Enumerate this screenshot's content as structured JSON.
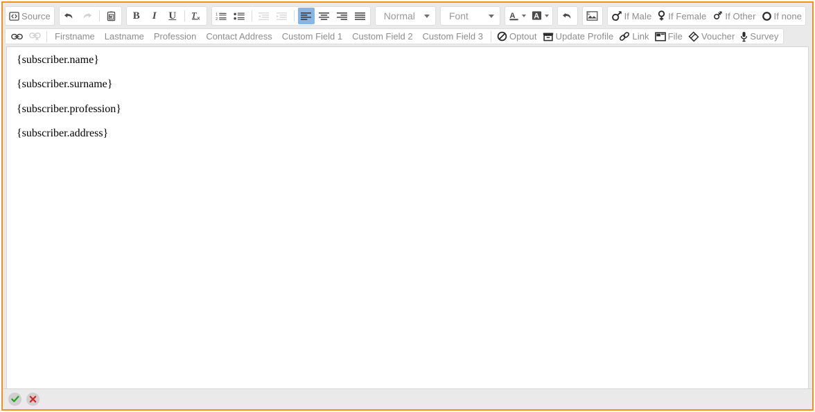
{
  "editor": {
    "frame_accent_color": "#f0901e",
    "toolbar_bg": "#eaeaea",
    "active_button_color": "#86b5e6"
  },
  "toolbar": {
    "row1": {
      "source_label": "Source",
      "undo_title": "Undo",
      "redo_title": "Redo",
      "paste_word_title": "Paste from Word",
      "bold_label": "B",
      "italic_label": "I",
      "underline_label": "U",
      "remove_format_label": "Tx",
      "numbered_list_title": "Insert/Remove Numbered List",
      "bulleted_list_title": "Insert/Remove Bulleted List",
      "outdent_title": "Decrease Indent",
      "indent_title": "Increase Indent",
      "align_left_title": "Align Left",
      "align_center_title": "Center",
      "align_right_title": "Align Right",
      "justify_title": "Justify",
      "paragraph_format": "Normal",
      "font_name": "Font",
      "text_color_title": "Text Color",
      "bg_color_title": "Background Color",
      "undo_arrow_title": "Undo",
      "image_title": "Image",
      "if_male": "If Male",
      "if_female": "If Female",
      "if_other": "If Other",
      "if_none": "If none"
    },
    "row2": {
      "link_title": "Link",
      "unlink_title": "Unlink",
      "fields": [
        "Firstname",
        "Lastname",
        "Profession",
        "Contact Address",
        "Custom Field 1",
        "Custom Field 2",
        "Custom Field 3"
      ],
      "optout": "Optout",
      "update_profile": "Update Profile",
      "link": "Link",
      "file": "File",
      "voucher": "Voucher",
      "survey": "Survey"
    }
  },
  "content": {
    "paragraphs": [
      "{subscriber.name}",
      "{subscriber.surname}",
      "{subscriber.profession}",
      "{subscriber.address}"
    ]
  },
  "bottom_bar": {
    "confirm_title": "Save",
    "cancel_title": "Cancel",
    "confirm_color": "#22a11a",
    "cancel_color": "#dd2222"
  }
}
